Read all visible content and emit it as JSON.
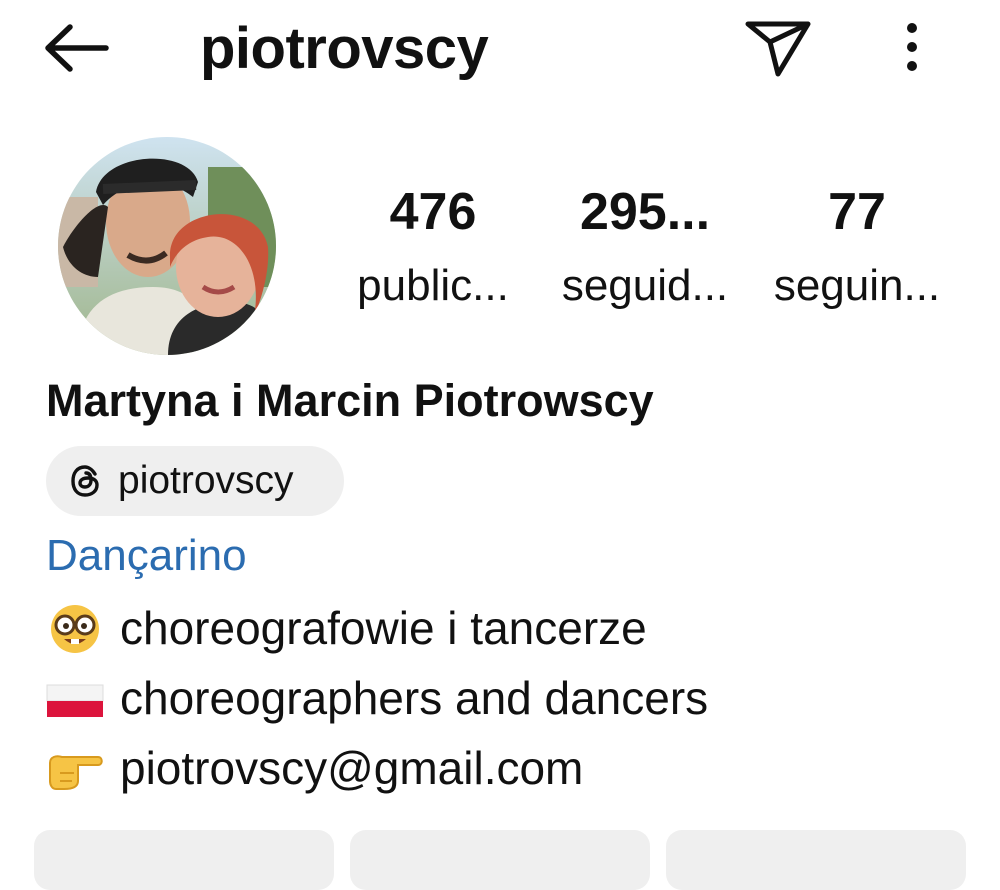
{
  "header": {
    "title": "piotrovscy",
    "back_icon": "arrow-left-icon",
    "send_icon": "paper-plane-icon",
    "more_icon": "more-vertical-icon"
  },
  "profile": {
    "avatar_icon": "avatar",
    "stats": [
      {
        "value": "476",
        "label": "public..."
      },
      {
        "value": "295...",
        "label": "seguid..."
      },
      {
        "value": "77",
        "label": "seguin..."
      }
    ],
    "display_name": "Martyna i Marcin Piotrowscy",
    "threads_handle": "piotrovscy",
    "threads_icon": "threads-icon",
    "category": "Dançarino",
    "category_color": "#2b6cb0",
    "bio": [
      {
        "icon": "nerd-face-emoji-icon",
        "text": "choreografowie i tancerze"
      },
      {
        "icon": "poland-flag-icon",
        "text": "choreographers and dancers"
      },
      {
        "icon": "pointing-right-emoji-icon",
        "text": "piotrovscy@gmail.com"
      }
    ]
  },
  "colors": {
    "background": "#ffffff",
    "text": "#111111",
    "chip_bg": "#efefef"
  }
}
